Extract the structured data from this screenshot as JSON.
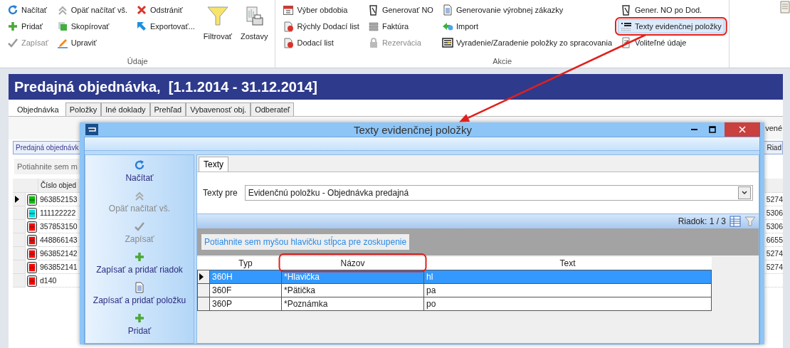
{
  "ribbon": {
    "groups": [
      {
        "label": "Údaje",
        "columns": [
          [
            {
              "label": "Načítať",
              "disabled": false,
              "highlighted": false,
              "callout": false
            },
            {
              "label": "Pridať",
              "disabled": false,
              "highlighted": false,
              "callout": false
            },
            {
              "label": "Zapísať",
              "disabled": true,
              "highlighted": false,
              "callout": false
            }
          ],
          [
            {
              "label": "Opäť načítať vš.",
              "disabled": false,
              "highlighted": false,
              "callout": false
            },
            {
              "label": "Skopírovať",
              "disabled": false,
              "highlighted": false,
              "callout": false
            },
            {
              "label": "Upraviť",
              "disabled": false,
              "highlighted": false,
              "callout": false
            }
          ],
          [
            {
              "label": "Odstrániť",
              "disabled": false,
              "highlighted": false,
              "callout": false
            },
            {
              "label": "Exportovať...",
              "disabled": false,
              "highlighted": false,
              "callout": false
            }
          ]
        ],
        "large_buttons": [
          {
            "label": "Filtrovať"
          },
          {
            "label": "Zostavy"
          }
        ]
      },
      {
        "label": "Akcie",
        "columns": [
          [
            {
              "label": "Výber obdobia",
              "disabled": false,
              "highlighted": false,
              "callout": false
            },
            {
              "label": "Rýchly Dodací list",
              "disabled": false,
              "highlighted": false,
              "callout": false
            },
            {
              "label": "Dodací list",
              "disabled": false,
              "highlighted": false,
              "callout": false
            }
          ],
          [
            {
              "label": "Generovať NO",
              "disabled": false,
              "highlighted": false,
              "callout": false
            },
            {
              "label": "Faktúra",
              "disabled": false,
              "highlighted": false,
              "callout": false
            },
            {
              "label": "Rezervácia",
              "disabled": true,
              "highlighted": false,
              "callout": false
            }
          ],
          [
            {
              "label": "Generovanie výrobnej zákazky",
              "disabled": false,
              "highlighted": false,
              "callout": false
            },
            {
              "label": "Import",
              "disabled": false,
              "highlighted": false,
              "callout": false
            },
            {
              "label": "Vyradenie/Zaradenie položky zo spracovania",
              "disabled": false,
              "highlighted": false,
              "callout": false
            }
          ],
          [
            {
              "label": "Gener. NO po Dod.",
              "disabled": false,
              "highlighted": false,
              "callout": false
            },
            {
              "label": "Texty evidenčnej položky",
              "disabled": false,
              "highlighted": true,
              "callout": true
            },
            {
              "label": "Voliteľné údaje",
              "disabled": false,
              "highlighted": false,
              "callout": false
            }
          ]
        ]
      }
    ]
  },
  "app": {
    "title": "Predajná objednávka,  [1.1.2014 - 31.12.2014]",
    "tabs": [
      {
        "label": "Objednávka",
        "selected": true
      },
      {
        "label": "Položky",
        "selected": false
      },
      {
        "label": "Iné doklady",
        "selected": false
      },
      {
        "label": "Prehľad",
        "selected": false
      },
      {
        "label": "Vybavenosť obj.",
        "selected": false
      },
      {
        "label": "Odberateľ",
        "selected": false
      }
    ],
    "header_fragment": "vené",
    "group_bar": {
      "left": "Predajná objednávk",
      "right": "Riad"
    },
    "group_panel": "Potiahnite sem m",
    "column": "Číslo objed",
    "rows": [
      {
        "number": "963852153",
        "color": "#00c000",
        "current": true,
        "last": "5274"
      },
      {
        "number": "111122222",
        "color": "#00e0e0",
        "current": false,
        "last": "5306"
      },
      {
        "number": "357853150",
        "color": "#ff0000",
        "current": false,
        "last": "5306"
      },
      {
        "number": "448866143",
        "color": "#ff0000",
        "current": false,
        "last": "6655"
      },
      {
        "number": "963852142",
        "color": "#ff0000",
        "current": false,
        "last": "5274"
      },
      {
        "number": "963852141",
        "color": "#ff0000",
        "current": false,
        "last": "5274"
      },
      {
        "number": "d140",
        "color": "#ff0000",
        "current": false,
        "last": ""
      }
    ]
  },
  "dialog": {
    "title": "Texty evidenčnej položky",
    "actions": [
      {
        "label": "Načítať",
        "disabled": false
      },
      {
        "label": "Opäť načítať vš.",
        "disabled": true
      },
      {
        "label": "Zapísať",
        "disabled": true
      },
      {
        "label": "Zapísať a pridať riadok",
        "disabled": false
      },
      {
        "label": "Zapísať a pridať položku",
        "disabled": false
      },
      {
        "label": "Pridať",
        "disabled": false
      }
    ],
    "tabs": [
      {
        "label": "Texty",
        "selected": true
      }
    ],
    "texts_for": {
      "label": "Texty pre",
      "value": "Evidenčnú položku - Objednávka predajná"
    },
    "row_counter": "Riadok: 1 / 3",
    "group_panel": "Potiahnite sem myšou hlavičku stĺpca pre zoskupenie",
    "grid": {
      "columns": [
        {
          "label": "Typ",
          "callout": false
        },
        {
          "label": "Názov",
          "callout": true
        },
        {
          "label": "Text",
          "callout": false
        }
      ],
      "rows": [
        {
          "cells": [
            "360H",
            "*Hlavička",
            "hl"
          ],
          "selected": true
        },
        {
          "cells": [
            "360F",
            "*Pätička",
            "pa"
          ],
          "selected": false
        },
        {
          "cells": [
            "360P",
            "*Poznámka",
            "po"
          ],
          "selected": false
        }
      ]
    }
  },
  "callout_arrow": true
}
